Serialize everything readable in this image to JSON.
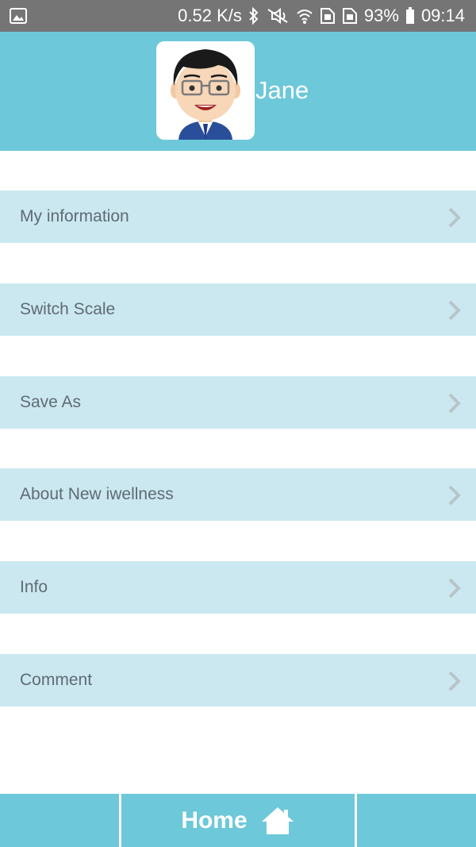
{
  "status_bar": {
    "network_speed": "0.52 K/s",
    "battery": "93%",
    "time": "09:14",
    "icons": [
      "image-notification-icon",
      "bluetooth-icon",
      "mute-icon",
      "wifi-icon",
      "sim1-icon",
      "sim2-icon",
      "battery-icon"
    ]
  },
  "profile": {
    "name": "Jane",
    "avatar_icon": "cartoon-avatar"
  },
  "menu": [
    {
      "label": "My information",
      "icon": "chevron-right-icon"
    },
    {
      "label": "Switch Scale",
      "icon": "chevron-right-icon"
    },
    {
      "label": "Save As",
      "icon": "chevron-right-icon"
    },
    {
      "label": "About New iwellness",
      "icon": "chevron-right-icon"
    },
    {
      "label": "Info",
      "icon": "chevron-right-icon"
    },
    {
      "label": "Comment",
      "icon": "chevron-right-icon"
    }
  ],
  "bottom_nav": {
    "home_label": "Home",
    "home_icon": "home-icon"
  },
  "colors": {
    "accent": "#6dc8d9",
    "menu_bg": "#cbe8f1",
    "menu_text": "#5f6b73",
    "status_bar": "#757575"
  }
}
